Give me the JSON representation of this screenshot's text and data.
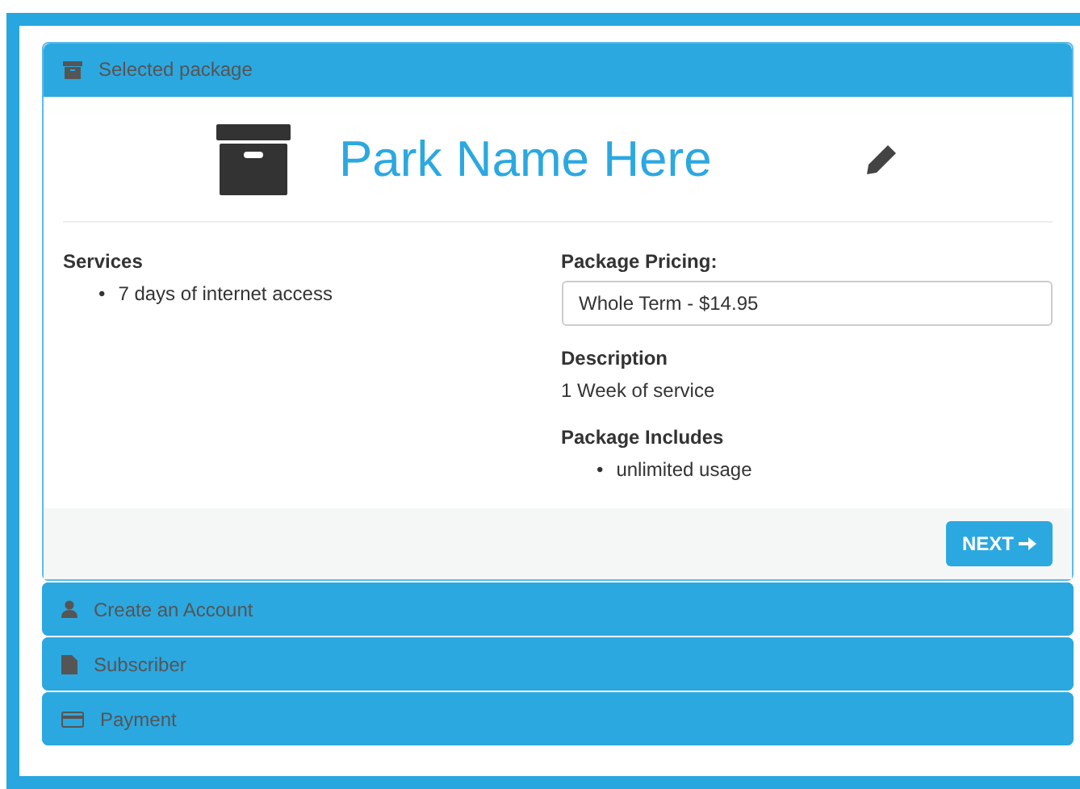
{
  "steps": [
    {
      "kind": "package",
      "title": "Selected package",
      "expanded": true
    },
    {
      "kind": "account",
      "title": "Create an Account",
      "expanded": false
    },
    {
      "kind": "subscriber",
      "title": "Subscriber",
      "expanded": false
    },
    {
      "kind": "payment",
      "title": "Payment",
      "expanded": false
    }
  ],
  "package": {
    "name": "Park Name Here",
    "bullet": "•",
    "services": {
      "heading": "Services",
      "items": [
        "7 days of internet access"
      ]
    },
    "pricing": {
      "label": "Package Pricing:",
      "value": "Whole Term - $14.95"
    },
    "description": {
      "heading": "Description",
      "text": "1 Week of service"
    },
    "includes": {
      "heading": "Package Includes",
      "items": [
        "unlimited usage"
      ]
    },
    "next_button": "NEXT"
  }
}
